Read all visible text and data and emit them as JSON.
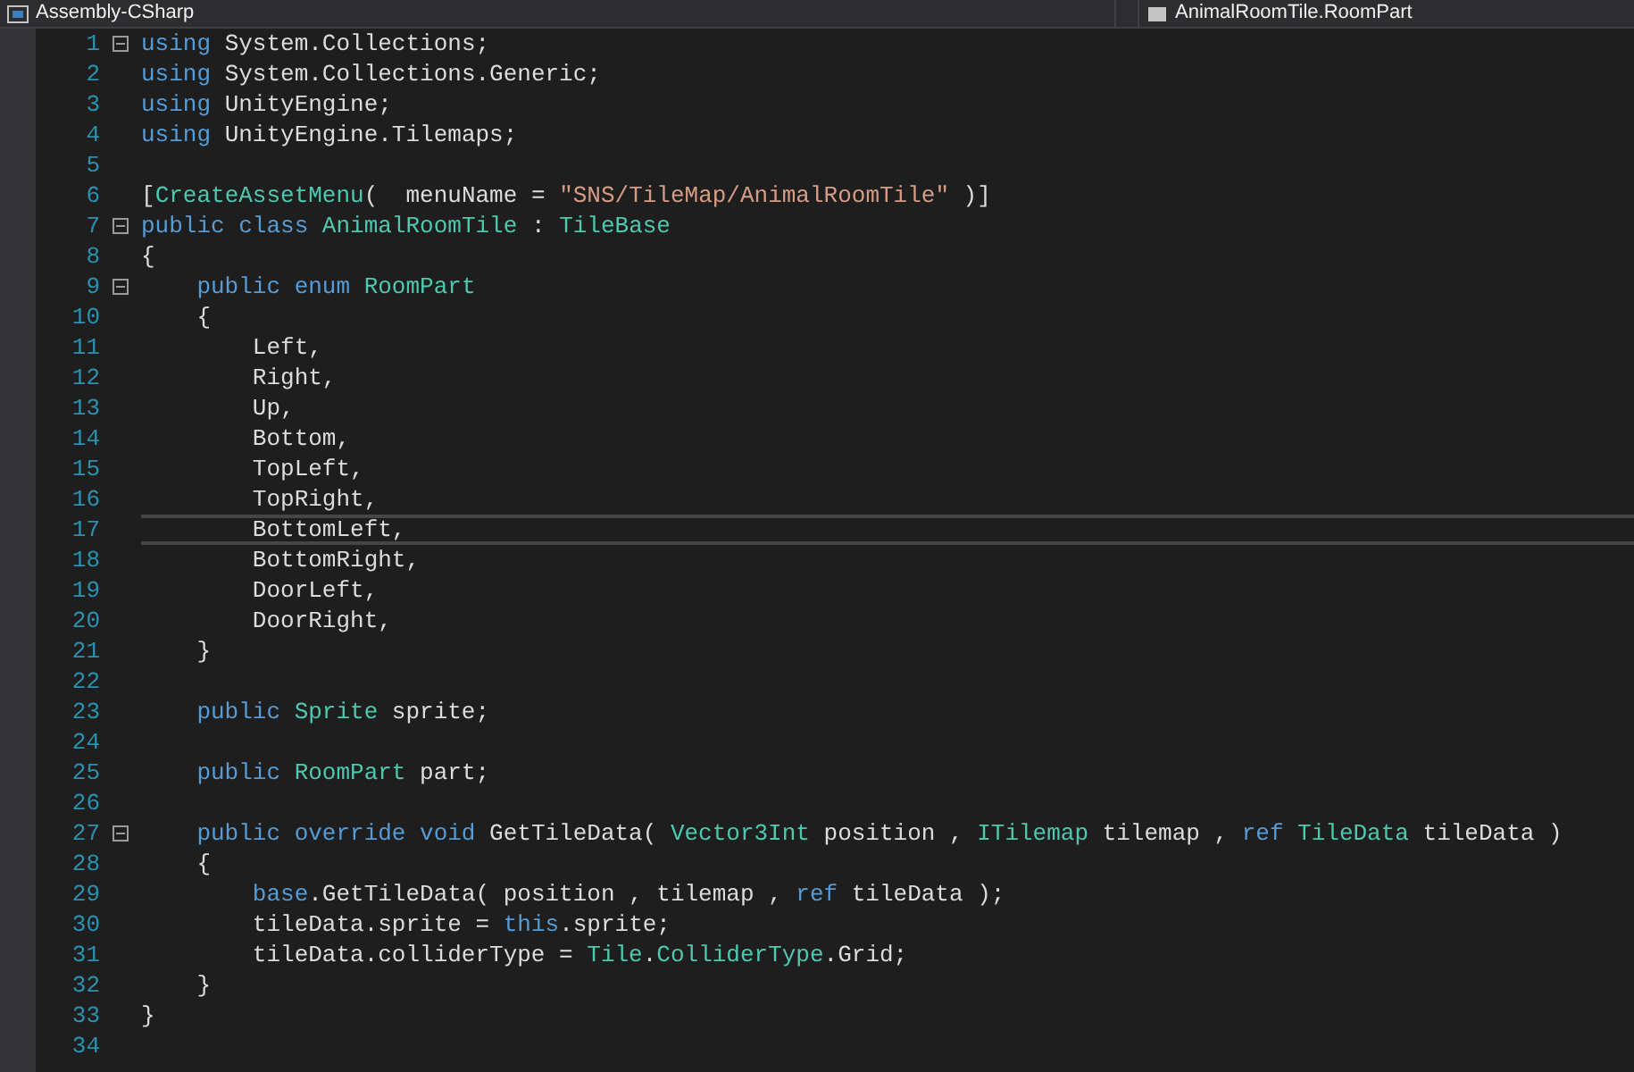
{
  "navigation_bar": {
    "project_dropdown": "Assembly-CSharp",
    "member_dropdown": "AnimalRoomTile.RoomPart"
  },
  "code_lines": [
    {
      "number": "1",
      "foldable": true,
      "current": false,
      "tokens": [
        {
          "kind": "keyword",
          "text": "using"
        },
        {
          "kind": "plain",
          "text": " System.Collections;"
        }
      ]
    },
    {
      "number": "2",
      "foldable": false,
      "current": false,
      "tokens": [
        {
          "kind": "keyword",
          "text": "using"
        },
        {
          "kind": "plain",
          "text": " System.Collections.Generic;"
        }
      ]
    },
    {
      "number": "3",
      "foldable": false,
      "current": false,
      "tokens": [
        {
          "kind": "keyword",
          "text": "using"
        },
        {
          "kind": "plain",
          "text": " UnityEngine;"
        }
      ]
    },
    {
      "number": "4",
      "foldable": false,
      "current": false,
      "tokens": [
        {
          "kind": "keyword",
          "text": "using"
        },
        {
          "kind": "plain",
          "text": " UnityEngine.Tilemaps;"
        }
      ]
    },
    {
      "number": "5",
      "foldable": false,
      "current": false
    },
    {
      "number": "6",
      "foldable": false,
      "current": false,
      "tokens": [
        {
          "kind": "plain",
          "text": "["
        },
        {
          "kind": "type",
          "text": "CreateAssetMenu"
        },
        {
          "kind": "plain",
          "text": "(  menuName = "
        },
        {
          "kind": "string",
          "text": "\"SNS/TileMap/AnimalRoomTile\""
        },
        {
          "kind": "plain",
          "text": " )]"
        }
      ]
    },
    {
      "number": "7",
      "foldable": true,
      "current": false,
      "tokens": [
        {
          "kind": "keyword",
          "text": "public class"
        },
        {
          "kind": "type",
          "text": " AnimalRoomTile"
        },
        {
          "kind": "plain",
          "text": " : "
        },
        {
          "kind": "type",
          "text": "TileBase"
        }
      ]
    },
    {
      "number": "8",
      "foldable": false,
      "current": false,
      "tokens": [
        {
          "kind": "plain",
          "text": "{"
        }
      ]
    },
    {
      "number": "9",
      "foldable": true,
      "current": false,
      "tokens": [
        {
          "kind": "keyword",
          "text": "    public enum"
        },
        {
          "kind": "type",
          "text": " RoomPart"
        }
      ]
    },
    {
      "number": "10",
      "foldable": false,
      "current": false,
      "tokens": [
        {
          "kind": "plain",
          "text": "    {"
        }
      ]
    },
    {
      "number": "11",
      "foldable": false,
      "current": false,
      "tokens": [
        {
          "kind": "plain",
          "text": "        Left,"
        }
      ]
    },
    {
      "number": "12",
      "foldable": false,
      "current": false,
      "tokens": [
        {
          "kind": "plain",
          "text": "        Right,"
        }
      ]
    },
    {
      "number": "13",
      "foldable": false,
      "current": false,
      "tokens": [
        {
          "kind": "plain",
          "text": "        Up,"
        }
      ]
    },
    {
      "number": "14",
      "foldable": false,
      "current": false,
      "tokens": [
        {
          "kind": "plain",
          "text": "        Bottom,"
        }
      ]
    },
    {
      "number": "15",
      "foldable": false,
      "current": false,
      "tokens": [
        {
          "kind": "plain",
          "text": "        TopLeft,"
        }
      ]
    },
    {
      "number": "16",
      "foldable": false,
      "current": false,
      "tokens": [
        {
          "kind": "plain",
          "text": "        TopRight,"
        }
      ]
    },
    {
      "number": "17",
      "foldable": false,
      "current": true,
      "tokens": [
        {
          "kind": "plain",
          "text": "        BottomLeft,"
        }
      ]
    },
    {
      "number": "18",
      "foldable": false,
      "current": false,
      "tokens": [
        {
          "kind": "plain",
          "text": "        BottomRight,"
        }
      ]
    },
    {
      "number": "19",
      "foldable": false,
      "current": false,
      "tokens": [
        {
          "kind": "plain",
          "text": "        DoorLeft,"
        }
      ]
    },
    {
      "number": "20",
      "foldable": false,
      "current": false,
      "tokens": [
        {
          "kind": "plain",
          "text": "        DoorRight,"
        }
      ]
    },
    {
      "number": "21",
      "foldable": false,
      "current": false,
      "tokens": [
        {
          "kind": "plain",
          "text": "    }"
        }
      ]
    },
    {
      "number": "22",
      "foldable": false,
      "current": false
    },
    {
      "number": "23",
      "foldable": false,
      "current": false,
      "tokens": [
        {
          "kind": "keyword",
          "text": "    public"
        },
        {
          "kind": "type",
          "text": " Sprite"
        },
        {
          "kind": "plain",
          "text": " sprite;"
        }
      ]
    },
    {
      "number": "24",
      "foldable": false,
      "current": false
    },
    {
      "number": "25",
      "foldable": false,
      "current": false,
      "tokens": [
        {
          "kind": "keyword",
          "text": "    public"
        },
        {
          "kind": "type",
          "text": " RoomPart"
        },
        {
          "kind": "plain",
          "text": " part;"
        }
      ]
    },
    {
      "number": "26",
      "foldable": false,
      "current": false
    },
    {
      "number": "27",
      "foldable": true,
      "current": false,
      "tokens": [
        {
          "kind": "keyword",
          "text": "    public override void"
        },
        {
          "kind": "plain",
          "text": " GetTileData( "
        },
        {
          "kind": "type",
          "text": "Vector3Int"
        },
        {
          "kind": "plain",
          "text": " position , "
        },
        {
          "kind": "type",
          "text": "ITilemap"
        },
        {
          "kind": "plain",
          "text": " tilemap , "
        },
        {
          "kind": "keyword",
          "text": "ref"
        },
        {
          "kind": "type",
          "text": " TileData"
        },
        {
          "kind": "plain",
          "text": " tileData )"
        }
      ]
    },
    {
      "number": "28",
      "foldable": false,
      "current": false,
      "tokens": [
        {
          "kind": "plain",
          "text": "    {"
        }
      ]
    },
    {
      "number": "29",
      "foldable": false,
      "current": false,
      "tokens": [
        {
          "kind": "keyword",
          "text": "        base"
        },
        {
          "kind": "plain",
          "text": ".GetTileData( position , tilemap , "
        },
        {
          "kind": "keyword",
          "text": "ref"
        },
        {
          "kind": "plain",
          "text": " tileData );"
        }
      ]
    },
    {
      "number": "30",
      "foldable": false,
      "current": false,
      "tokens": [
        {
          "kind": "plain",
          "text": "        tileData.sprite = "
        },
        {
          "kind": "keyword",
          "text": "this"
        },
        {
          "kind": "plain",
          "text": ".sprite;"
        }
      ]
    },
    {
      "number": "31",
      "foldable": false,
      "current": false,
      "tokens": [
        {
          "kind": "plain",
          "text": "        tileData.colliderType = "
        },
        {
          "kind": "type",
          "text": "Tile"
        },
        {
          "kind": "plain",
          "text": "."
        },
        {
          "kind": "type",
          "text": "ColliderType"
        },
        {
          "kind": "plain",
          "text": ".Grid;"
        }
      ]
    },
    {
      "number": "32",
      "foldable": false,
      "current": false,
      "tokens": [
        {
          "kind": "plain",
          "text": "    }"
        }
      ]
    },
    {
      "number": "33",
      "foldable": false,
      "current": false,
      "tokens": [
        {
          "kind": "plain",
          "text": "}"
        }
      ]
    },
    {
      "number": "34",
      "foldable": false,
      "current": false
    }
  ]
}
